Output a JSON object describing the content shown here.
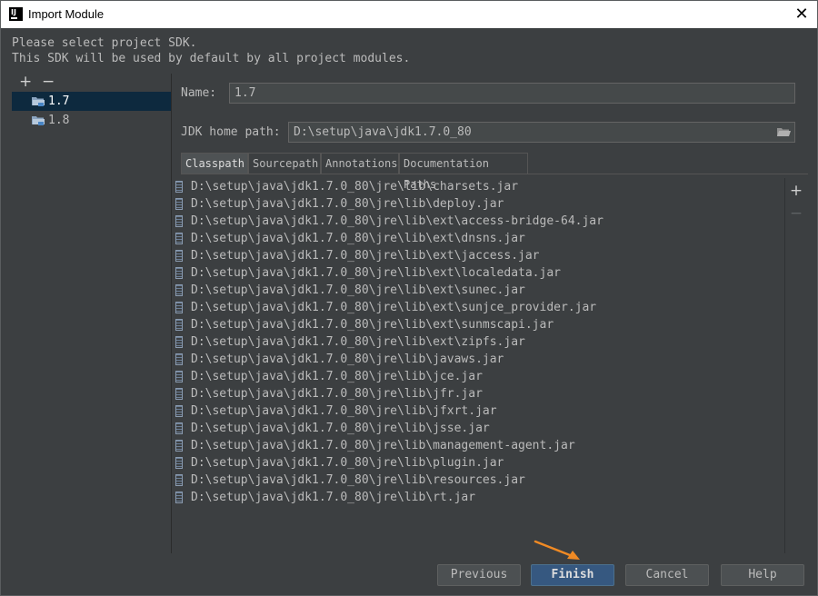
{
  "window": {
    "title": "Import Module"
  },
  "description": {
    "line1": "Please select project SDK.",
    "line2": "This SDK will be used by default by all project modules."
  },
  "sdk_toolbar": {
    "add": "+",
    "remove": "−"
  },
  "sdk_list": [
    {
      "label": "1.7",
      "selected": true
    },
    {
      "label": "1.8",
      "selected": false
    }
  ],
  "form": {
    "name_label": "Name:",
    "name_value": "1.7",
    "jdk_label": "JDK home path:",
    "jdk_value": "D:\\setup\\java\\jdk1.7.0_80"
  },
  "tabs": [
    {
      "label": "Classpath",
      "active": true
    },
    {
      "label": "Sourcepath",
      "active": false
    },
    {
      "label": "Annotations",
      "active": false
    },
    {
      "label": "Documentation Paths",
      "active": false
    }
  ],
  "classpath": [
    "D:\\setup\\java\\jdk1.7.0_80\\jre\\lib\\charsets.jar",
    "D:\\setup\\java\\jdk1.7.0_80\\jre\\lib\\deploy.jar",
    "D:\\setup\\java\\jdk1.7.0_80\\jre\\lib\\ext\\access-bridge-64.jar",
    "D:\\setup\\java\\jdk1.7.0_80\\jre\\lib\\ext\\dnsns.jar",
    "D:\\setup\\java\\jdk1.7.0_80\\jre\\lib\\ext\\jaccess.jar",
    "D:\\setup\\java\\jdk1.7.0_80\\jre\\lib\\ext\\localedata.jar",
    "D:\\setup\\java\\jdk1.7.0_80\\jre\\lib\\ext\\sunec.jar",
    "D:\\setup\\java\\jdk1.7.0_80\\jre\\lib\\ext\\sunjce_provider.jar",
    "D:\\setup\\java\\jdk1.7.0_80\\jre\\lib\\ext\\sunmscapi.jar",
    "D:\\setup\\java\\jdk1.7.0_80\\jre\\lib\\ext\\zipfs.jar",
    "D:\\setup\\java\\jdk1.7.0_80\\jre\\lib\\javaws.jar",
    "D:\\setup\\java\\jdk1.7.0_80\\jre\\lib\\jce.jar",
    "D:\\setup\\java\\jdk1.7.0_80\\jre\\lib\\jfr.jar",
    "D:\\setup\\java\\jdk1.7.0_80\\jre\\lib\\jfxrt.jar",
    "D:\\setup\\java\\jdk1.7.0_80\\jre\\lib\\jsse.jar",
    "D:\\setup\\java\\jdk1.7.0_80\\jre\\lib\\management-agent.jar",
    "D:\\setup\\java\\jdk1.7.0_80\\jre\\lib\\plugin.jar",
    "D:\\setup\\java\\jdk1.7.0_80\\jre\\lib\\resources.jar",
    "D:\\setup\\java\\jdk1.7.0_80\\jre\\lib\\rt.jar"
  ],
  "side_toolbar": {
    "add": "+",
    "remove": "−"
  },
  "buttons": {
    "previous": "Previous",
    "finish": "Finish",
    "cancel": "Cancel",
    "help": "Help"
  },
  "colors": {
    "background": "#3c3f41",
    "selection": "#0d293e",
    "primary_button": "#365880",
    "annotation_arrow": "#f08a24"
  }
}
